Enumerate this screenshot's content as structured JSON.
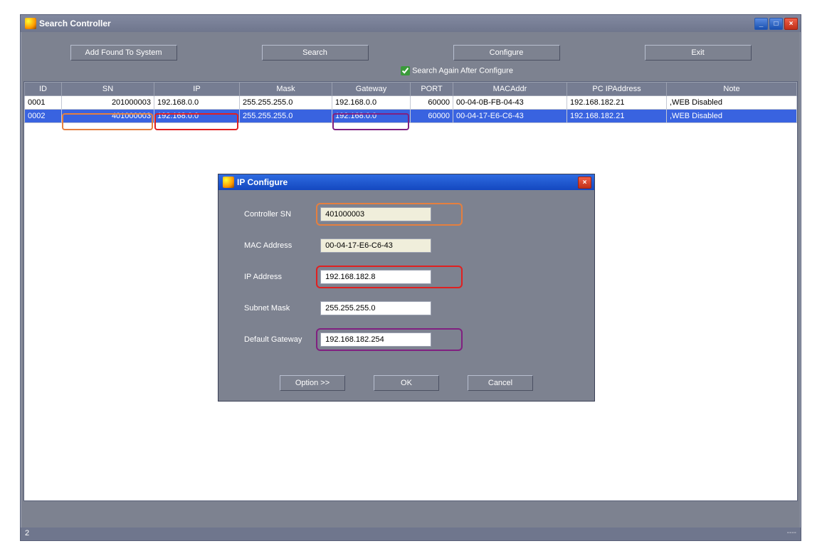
{
  "window": {
    "title": "Search Controller",
    "toolbar": {
      "add_found": "Add Found To System",
      "search": "Search",
      "configure": "Configure",
      "exit": "Exit"
    },
    "checkbox_label": "Search Again After Configure",
    "columns": {
      "id": "ID",
      "sn": "SN",
      "ip": "IP",
      "mask": "Mask",
      "gateway": "Gateway",
      "port": "PORT",
      "mac": "MACAddr",
      "pcip": "PC IPAddress",
      "note": "Note"
    },
    "rows": [
      {
        "id": "0001",
        "sn": "201000003",
        "ip": "192.168.0.0",
        "mask": "255.255.255.0",
        "gateway": "192.168.0.0",
        "port": "60000",
        "mac": "00-04-0B-FB-04-43",
        "pcip": "192.168.182.21",
        "note": ",WEB Disabled"
      },
      {
        "id": "0002",
        "sn": "401000003",
        "ip": "192.168.0.0",
        "mask": "255.255.255.0",
        "gateway": "192.168.0.0",
        "port": "60000",
        "mac": "00-04-17-E6-C6-43",
        "pcip": "192.168.182.21",
        "note": ",WEB Disabled"
      }
    ],
    "status_left": "2",
    "status_right": "----"
  },
  "dialog": {
    "title": "IP Configure",
    "labels": {
      "sn": "Controller SN",
      "mac": "MAC Address",
      "ip": "IP Address",
      "mask": "Subnet Mask",
      "gw": "Default Gateway"
    },
    "values": {
      "sn": "401000003",
      "mac": "00-04-17-E6-C6-43",
      "ip": "192.168.182.8",
      "mask": "255.255.255.0",
      "gw": "192.168.182.254"
    },
    "buttons": {
      "option": "Option >>",
      "ok": "OK",
      "cancel": "Cancel"
    }
  },
  "annot_colors": {
    "orange": "#e57f3f",
    "red": "#e02020",
    "purple": "#802080"
  }
}
